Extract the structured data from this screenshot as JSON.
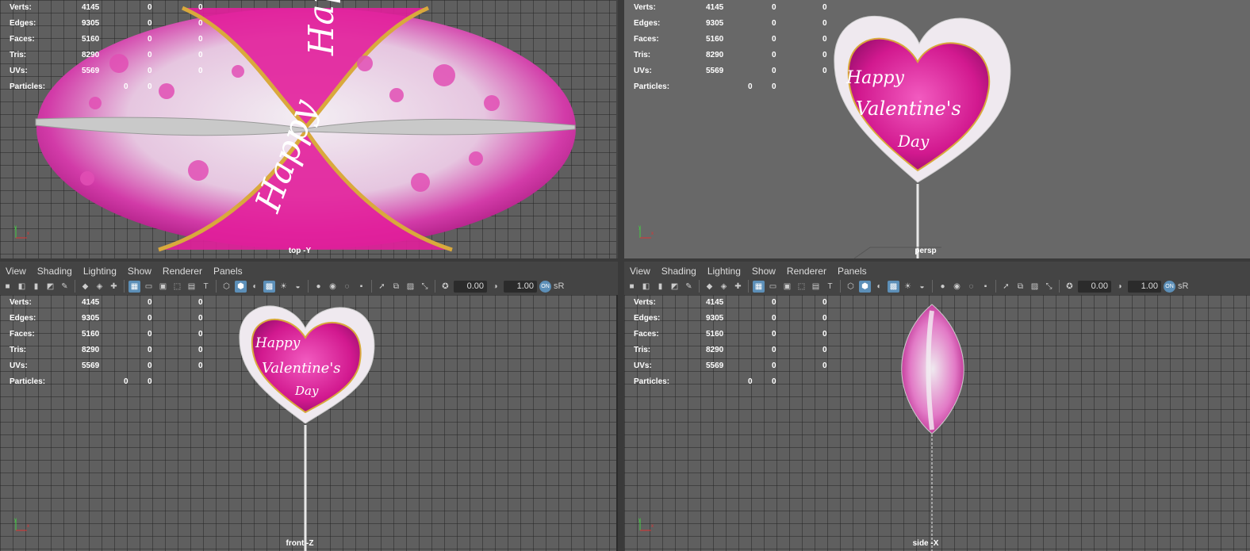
{
  "stats": {
    "verts": {
      "label": "Verts:",
      "v1": "4145",
      "v2": "0",
      "v3": "0"
    },
    "edges": {
      "label": "Edges:",
      "v1": "9305",
      "v2": "0",
      "v3": "0"
    },
    "faces": {
      "label": "Faces:",
      "v1": "5160",
      "v2": "0",
      "v3": "0"
    },
    "tris": {
      "label": "Tris:",
      "v1": "8290",
      "v2": "0",
      "v3": "0"
    },
    "uvs": {
      "label": "UVs:",
      "v1": "5569",
      "v2": "0",
      "v3": "0"
    },
    "particles": {
      "label": "Particles:",
      "v1": "0",
      "v2": "0"
    }
  },
  "menu": {
    "view": "View",
    "shading": "Shading",
    "lighting": "Lighting",
    "show": "Show",
    "renderer": "Renderer",
    "panels": "Panels"
  },
  "toolbar": {
    "exposure": "0.00",
    "gamma": "1.00",
    "color_mgmt": "ON",
    "srgb": "sR"
  },
  "cameras": {
    "top": "top -Y",
    "persp": "persp",
    "front": "front -Z",
    "side": "side -X"
  },
  "balloon": {
    "line1": "Happy",
    "line2": "Valentine's",
    "line3": "Day"
  },
  "colors": {
    "accent": "#5c8fb8",
    "balloon_pink": "#e21f9b",
    "balloon_light": "#efe9ef",
    "gold": "#d9a93c"
  }
}
